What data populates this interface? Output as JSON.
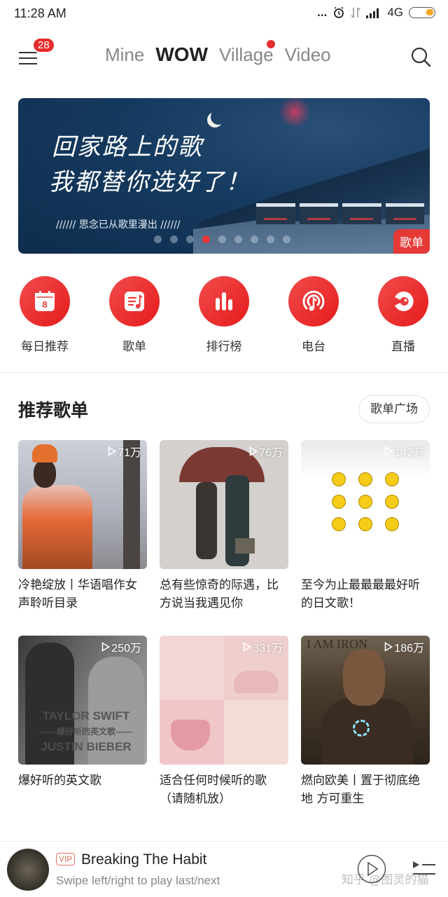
{
  "status_bar": {
    "time": "11:28 AM",
    "more": "...",
    "network": "4G"
  },
  "header": {
    "menu_badge": "28",
    "tabs": [
      {
        "label": "Mine",
        "active": false,
        "has_dot": false
      },
      {
        "label": "WOW",
        "active": true,
        "has_dot": false
      },
      {
        "label": "Village",
        "active": false,
        "has_dot": true
      },
      {
        "label": "Video",
        "active": false,
        "has_dot": false
      }
    ]
  },
  "banner": {
    "title_line1": "回家路上的歌",
    "title_line2": "我都替你选好了！",
    "subtitle": "////// 思念已从歌里漫出 //////",
    "tag": "歌单",
    "page_count": 9,
    "active_index": 3
  },
  "quick_nav": [
    {
      "label": "每日推荐",
      "icon": "calendar-icon",
      "calendar_day": "8"
    },
    {
      "label": "歌单",
      "icon": "playlist-icon"
    },
    {
      "label": "排行榜",
      "icon": "chart-bars-icon"
    },
    {
      "label": "电台",
      "icon": "radio-icon"
    },
    {
      "label": "直播",
      "icon": "live-icon"
    }
  ],
  "section": {
    "title": "推荐歌单",
    "more_button": "歌单广场"
  },
  "playlists": [
    {
      "plays": "71万",
      "title": "冷艳绽放丨华语唱作女声聆听目录"
    },
    {
      "plays": "76万",
      "title": "总有些惊奇的际遇，比方说当我遇见你"
    },
    {
      "plays": "142万",
      "title": "至今为止最最最最好听的日文歌！"
    },
    {
      "plays": "250万",
      "title": "爆好听的英文歌",
      "cover_text": [
        "TAYLOR SWIFT",
        "——爆好听的英文歌——",
        "JUSTIN BIEBER"
      ]
    },
    {
      "plays": "331万",
      "title": "适合任何时候听的歌（请随机放）"
    },
    {
      "plays": "186万",
      "title": "燃向欧美丨置于彻底绝地 方可重生",
      "cover_text": [
        "I AM IRON"
      ]
    }
  ],
  "player": {
    "badge": "VIP",
    "title": "Breaking The Habit",
    "subtitle": "Swipe left/right to play last/next",
    "watermark": "知乎 @图灵的猫"
  },
  "colors": {
    "accent": "#e62e2e",
    "banner_bg": "#153a5f"
  }
}
